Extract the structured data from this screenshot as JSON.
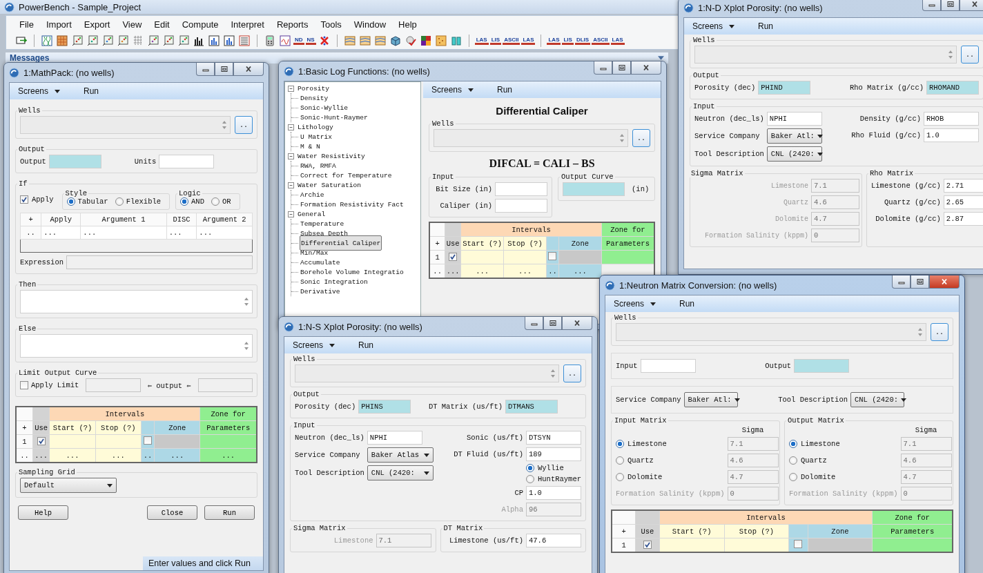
{
  "app": {
    "title": "PowerBench - Sample_Project",
    "menu": [
      "File",
      "Import",
      "Export",
      "View",
      "Edit",
      "Compute",
      "Interpret",
      "Reports",
      "Tools",
      "Window",
      "Help"
    ],
    "toolbar": [
      {
        "kind": "exit"
      },
      {
        "kind": "separator"
      },
      {
        "kind": "curves"
      },
      {
        "kind": "map"
      },
      {
        "kind": "crossplot"
      },
      {
        "kind": "crossplot"
      },
      {
        "kind": "crossplot"
      },
      {
        "kind": "crossplot"
      },
      {
        "kind": "grid"
      },
      {
        "kind": "crossplot"
      },
      {
        "kind": "crossplot"
      },
      {
        "kind": "crossplot"
      },
      {
        "kind": "histogram"
      },
      {
        "kind": "chart"
      },
      {
        "kind": "chart"
      },
      {
        "kind": "table"
      },
      {
        "kind": "separator"
      },
      {
        "kind": "calculator"
      },
      {
        "kind": "function"
      },
      {
        "kind": "text",
        "label": "ND"
      },
      {
        "kind": "text",
        "label": "NS"
      },
      {
        "kind": "cross"
      },
      {
        "kind": "separator"
      },
      {
        "kind": "strata"
      },
      {
        "kind": "strata"
      },
      {
        "kind": "strata"
      },
      {
        "kind": "cube"
      },
      {
        "kind": "check"
      },
      {
        "kind": "palette"
      },
      {
        "kind": "sand"
      },
      {
        "kind": "tanks"
      },
      {
        "kind": "separator"
      },
      {
        "kind": "text",
        "label": "LAS"
      },
      {
        "kind": "text",
        "label": "LIS"
      },
      {
        "kind": "text",
        "label": "ASCII"
      },
      {
        "kind": "text",
        "label": "LAS"
      },
      {
        "kind": "separator"
      },
      {
        "kind": "text",
        "label": "LAS"
      },
      {
        "kind": "text",
        "label": "LIS"
      },
      {
        "kind": "text",
        "label": "DLIS"
      },
      {
        "kind": "text",
        "label": "ASCII"
      },
      {
        "kind": "text",
        "label": "LAS"
      }
    ],
    "messages": "Messages"
  },
  "mathpack": {
    "title": "1:MathPack: (no wells)",
    "active": false,
    "menu": [
      {
        "label": "Screens",
        "dropdown": true
      },
      {
        "label": "Run",
        "dropdown": false
      }
    ],
    "wells": {
      "label": "Wells",
      "button": ".."
    },
    "output": {
      "title": "Output",
      "fields": [
        {
          "label": "Output"
        },
        {
          "label": "Units"
        }
      ]
    },
    "if": {
      "title": "If",
      "apply": {
        "label": "Apply",
        "checked": true
      },
      "style": {
        "title": "Style",
        "options": [
          {
            "label": "Tabular",
            "selected": true
          },
          {
            "label": "Flexible",
            "selected": false
          }
        ]
      },
      "logic": {
        "title": "Logic",
        "options": [
          {
            "label": "AND",
            "selected": true
          },
          {
            "label": "OR",
            "selected": false
          }
        ]
      },
      "table": {
        "headers": [
          "+",
          "Apply",
          "Argument 1",
          "DISC",
          "Argument 2"
        ],
        "row": [
          "..",
          "...",
          "...",
          "...",
          "..."
        ]
      },
      "expression": "Expression"
    },
    "then": {
      "title": "Then"
    },
    "else": {
      "title": "Else"
    },
    "limit": {
      "title": "Limit Output Curve",
      "apply": {
        "label": "Apply Limit",
        "checked": false
      },
      "between": "⇐ output ⇐"
    },
    "grid": {
      "intervals": "Intervals",
      "zone_for": "Zone for",
      "headers": {
        "plus": "+",
        "use": "Use",
        "start": "Start (?)",
        "stop": "Stop (?)",
        "zone": "Zone",
        "params": "Parameters"
      },
      "rows": [
        {
          "kind": "entry",
          "index": "1",
          "use": true,
          "flag": false
        },
        {
          "kind": "more",
          "index": "..",
          "cells": [
            "...",
            "...",
            "...",
            "..",
            "...",
            "..."
          ]
        }
      ]
    },
    "sampling": {
      "title": "Sampling Grid",
      "value": "Default"
    },
    "buttons": [
      "Help",
      "Close",
      "Run"
    ],
    "status": "Enter values and click Run"
  },
  "basic_log": {
    "title": "1:Basic Log Functions: (no wells)",
    "active": false,
    "tree": [
      {
        "label": "Porosity",
        "expanded": true,
        "selected": false,
        "children": [
          {
            "label": "Density",
            "selected": false
          },
          {
            "label": "Sonic-Wyllie",
            "selected": false
          },
          {
            "label": "Sonic-Hunt-Raymer",
            "selected": false
          }
        ]
      },
      {
        "label": "Lithology",
        "expanded": true,
        "selected": false,
        "children": [
          {
            "label": "U Matrix",
            "selected": false
          },
          {
            "label": "M & N",
            "selected": false
          }
        ]
      },
      {
        "label": "Water Resistivity",
        "expanded": true,
        "selected": false,
        "children": [
          {
            "label": "RWA, RMFA",
            "selected": false
          },
          {
            "label": "Correct for Temperature",
            "selected": false
          }
        ]
      },
      {
        "label": "Water Saturation",
        "expanded": true,
        "selected": false,
        "children": [
          {
            "label": "Archie",
            "selected": false
          },
          {
            "label": "Formation Resistivity Fact",
            "selected": false
          }
        ]
      },
      {
        "label": "General",
        "expanded": true,
        "selected": false,
        "children": [
          {
            "label": "Temperature",
            "selected": false
          },
          {
            "label": "Subsea Depth",
            "selected": false
          },
          {
            "label": "Differential Caliper",
            "selected": true
          },
          {
            "label": "Min/Max",
            "selected": false
          },
          {
            "label": "Accumulate",
            "selected": false
          },
          {
            "label": "Borehole Volume Integratio",
            "selected": false
          },
          {
            "label": "Sonic Integration",
            "selected": false
          },
          {
            "label": "Derivative",
            "selected": false
          }
        ]
      }
    ],
    "menu": [
      {
        "label": "Screens",
        "dropdown": true
      },
      {
        "label": "Run",
        "dropdown": false
      }
    ],
    "heading": "Differential Caliper",
    "wells": {
      "label": "Wells",
      "button": ".."
    },
    "formula": "DIFCAL = CALI – BS",
    "input": {
      "title": "Input",
      "fields": [
        {
          "kind": "field",
          "label": "Bit Size (in)"
        },
        {
          "kind": "field",
          "label": "Caliper (in)"
        }
      ]
    },
    "output": {
      "title": "Output Curve",
      "units": "(in)"
    },
    "grid": {
      "intervals": "Intervals",
      "zone_for": "Zone for",
      "headers": {
        "plus": "+",
        "use": "Use",
        "start": "Start (?)",
        "stop": "Stop (?)",
        "zone": "Zone",
        "params": "Parameters"
      },
      "rows": [
        {
          "kind": "entry",
          "index": "1",
          "use": true,
          "flag": false
        },
        {
          "kind": "more",
          "index": "..",
          "cells": [
            "...",
            "...",
            "...",
            "..",
            "..."
          ]
        }
      ]
    }
  },
  "nd_xplot": {
    "title": "1:N-D Xplot Porosity: (no wells)",
    "active": false,
    "menu": [
      {
        "label": "Screens",
        "dropdown": true
      },
      {
        "label": "Run",
        "dropdown": false
      }
    ],
    "wells": {
      "label": "Wells",
      "button": ".."
    },
    "output": {
      "title": "Output",
      "fields": [
        {
          "label": "Porosity (dec)",
          "value": "PHIND"
        },
        {
          "label": "Rho Matrix (g/cc)",
          "value": "RHOMAND"
        }
      ]
    },
    "input": {
      "title": "Input",
      "left": [
        {
          "kind": "field",
          "label": "Neutron (dec_ls)",
          "value": "NPHI"
        },
        {
          "kind": "select",
          "label": "Service Company",
          "value": "Baker Atl:"
        },
        {
          "kind": "select",
          "label": "Tool Description",
          "value": "CNL (2420:"
        }
      ],
      "right": [
        {
          "kind": "field",
          "label": "Density (g/cc)",
          "value": "RHOB"
        },
        {
          "kind": "field",
          "label": "Rho Fluid (g/cc)",
          "value": "1.0"
        }
      ]
    },
    "sigma": {
      "title": "Sigma Matrix",
      "fields": [
        {
          "kind": "field",
          "label": "Limestone",
          "value": "7.1",
          "disabled": true
        },
        {
          "kind": "field",
          "label": "Quartz",
          "value": "4.6",
          "disabled": true
        },
        {
          "kind": "field",
          "label": "Dolomite",
          "value": "4.7",
          "disabled": true
        },
        {
          "kind": "field",
          "label": "Formation Salinity (kppm)",
          "value": "0",
          "disabled": true
        }
      ]
    },
    "rho": {
      "title": "Rho Matrix",
      "fields": [
        {
          "kind": "field",
          "label": "Limestone (g/cc)",
          "value": "2.71",
          "disabled": false
        },
        {
          "kind": "field",
          "label": "Quartz (g/cc)",
          "value": "2.65",
          "disabled": false
        },
        {
          "kind": "field",
          "label": "Dolomite (g/cc)",
          "value": "2.87",
          "disabled": false
        }
      ]
    }
  },
  "ns_xplot": {
    "title": "1:N-S Xplot Porosity: (no wells)",
    "active": false,
    "menu": [
      {
        "label": "Screens",
        "dropdown": true
      },
      {
        "label": "Run",
        "dropdown": false
      }
    ],
    "wells": {
      "label": "Wells",
      "button": ".."
    },
    "output": {
      "title": "Output",
      "fields": [
        {
          "label": "Porosity (dec)",
          "value": "PHINS"
        },
        {
          "label": "DT Matrix (us/ft)",
          "value": "DTMANS"
        }
      ]
    },
    "input": {
      "title": "Input",
      "left": [
        {
          "kind": "field",
          "label": "Neutron (dec_ls)",
          "value": "NPHI"
        },
        {
          "kind": "select",
          "label": "Service Company",
          "value": "Baker Atlas"
        },
        {
          "kind": "select",
          "label": "Tool Description",
          "value": "CNL (2420:"
        }
      ],
      "right": [
        {
          "kind": "field",
          "label": "Sonic (us/ft)",
          "value": "DTSYN",
          "disabled": false
        },
        {
          "kind": "field",
          "label": "DT Fluid (us/ft)",
          "value": "189",
          "disabled": false
        },
        {
          "kind": "radio",
          "label": "Wyllie",
          "selected": true,
          "disabled": false
        },
        {
          "kind": "radio",
          "label": "HuntRaymer",
          "selected": false,
          "disabled": false
        },
        {
          "kind": "field",
          "label": "CP",
          "value": "1.0",
          "disabled": false
        },
        {
          "kind": "field",
          "label": "Alpha",
          "value": "96",
          "disabled": true
        }
      ]
    },
    "sigma": {
      "title": "Sigma Matrix",
      "fields": [
        {
          "kind": "field",
          "label": "Limestone",
          "value": "7.1",
          "disabled": true
        }
      ]
    },
    "dt": {
      "title": "DT Matrix",
      "fields": [
        {
          "kind": "field",
          "label": "Limestone (us/ft)",
          "value": "47.6",
          "disabled": false
        }
      ]
    }
  },
  "neutron_matrix": {
    "title": "1:Neutron Matrix Conversion: (no wells)",
    "active": true,
    "menu": [
      {
        "label": "Screens",
        "dropdown": true
      },
      {
        "label": "Run",
        "dropdown": false
      }
    ],
    "wells": {
      "label": "Wells",
      "button": ".."
    },
    "io": {
      "input_label": "Input",
      "output_label": "Output"
    },
    "company": {
      "label": "Service Company",
      "value": "Baker Atl:"
    },
    "tool": {
      "label": "Tool Description",
      "value": "CNL (2420:"
    },
    "matrices": [
      {
        "title": "Input Matrix",
        "column": "Sigma",
        "options": [
          {
            "label": "Limestone",
            "value": "7.1",
            "selected": true
          },
          {
            "label": "Quartz",
            "value": "4.6",
            "selected": false
          },
          {
            "label": "Dolomite",
            "value": "4.7",
            "selected": false
          }
        ],
        "salinity": {
          "label": "Formation Salinity (kppm)",
          "value": "0",
          "disabled": true
        }
      },
      {
        "title": "Output Matrix",
        "column": "Sigma",
        "options": [
          {
            "label": "Limestone",
            "value": "7.1",
            "selected": true
          },
          {
            "label": "Quartz",
            "value": "4.6",
            "selected": false
          },
          {
            "label": "Dolomite",
            "value": "4.7",
            "selected": false
          }
        ],
        "salinity": {
          "label": "Formation Salinity (kppm)",
          "value": "0",
          "disabled": true
        }
      }
    ],
    "grid": {
      "intervals": "Intervals",
      "zone_for": "Zone for",
      "headers": {
        "plus": "+",
        "use": "Use",
        "start": "Start (?)",
        "stop": "Stop (?)",
        "zone": "Zone",
        "params": "Parameters"
      },
      "rows": [
        {
          "kind": "entry",
          "index": "1",
          "use": true,
          "flag": false
        }
      ]
    }
  }
}
